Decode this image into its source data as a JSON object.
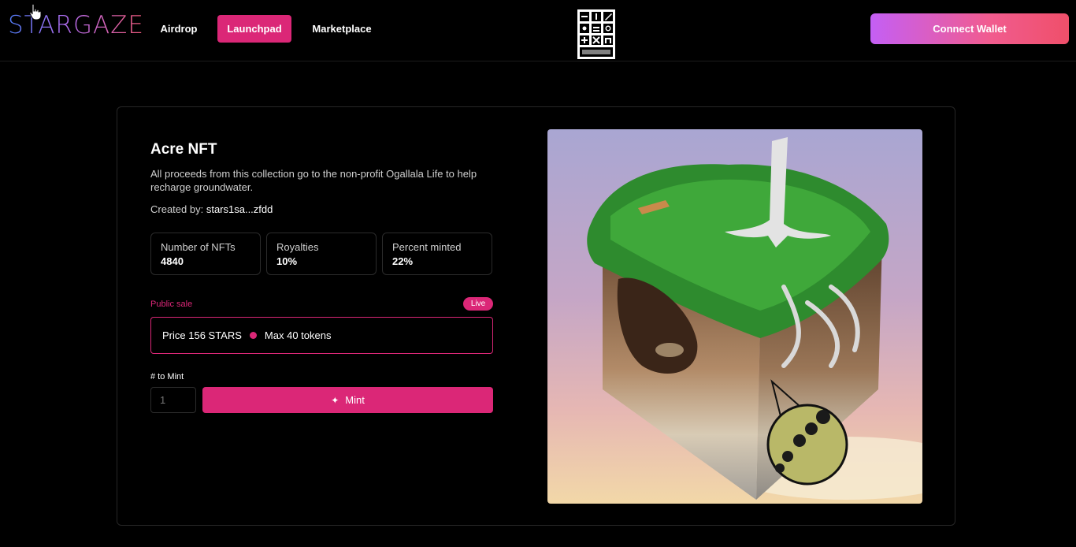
{
  "header": {
    "logo": "STARGAZE",
    "nav": [
      {
        "label": "Airdrop"
      },
      {
        "label": "Launchpad",
        "active": true
      },
      {
        "label": "Marketplace"
      }
    ],
    "connect_label": "Connect Wallet",
    "accent": "#db2777"
  },
  "collection": {
    "title": "Acre NFT",
    "description": "All proceeds from this collection go to the non-profit Ogallala Life to help recharge groundwater.",
    "created_by_label": "Created by:",
    "creator": "stars1sa...zfdd",
    "stats": [
      {
        "label": "Number of NFTs",
        "value": "4840"
      },
      {
        "label": "Royalties",
        "value": "10%"
      },
      {
        "label": "Percent minted",
        "value": "22%"
      }
    ]
  },
  "sale": {
    "label": "Public sale",
    "status": "Live",
    "price": "Price 156 STARS",
    "max": "Max 40 tokens"
  },
  "mint": {
    "label": "# to Mint",
    "placeholder": "1",
    "button_label": "Mint"
  }
}
